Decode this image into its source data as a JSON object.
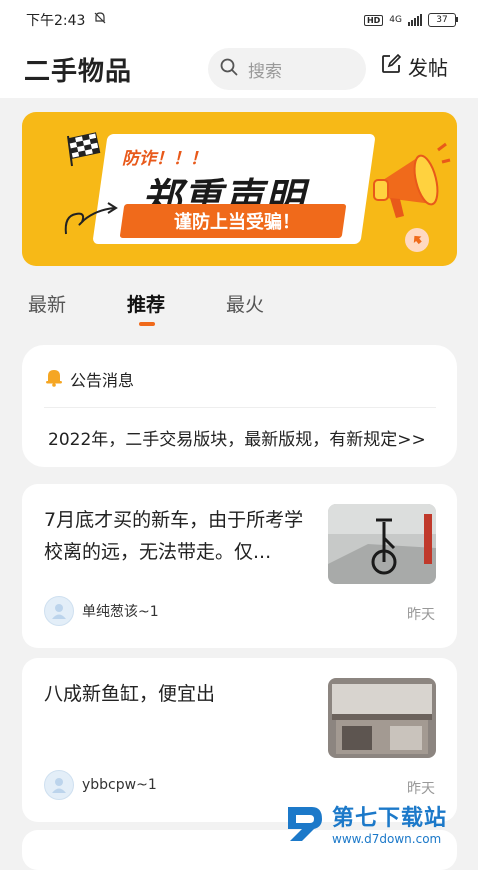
{
  "status_bar": {
    "time": "下午2:43",
    "hd": "HD",
    "network": "4G",
    "battery": "37"
  },
  "header": {
    "title": "二手物品",
    "search_placeholder": "搜索",
    "post_label": "发帖"
  },
  "banner": {
    "tag": "防诈！！！",
    "headline": "郑重声明",
    "subline": "谨防上当受骗！"
  },
  "tabs": [
    {
      "label": "最新",
      "active": false
    },
    {
      "label": "推荐",
      "active": true
    },
    {
      "label": "最火",
      "active": false
    }
  ],
  "notice": {
    "title": "公告消息",
    "text": "2022年，二手交易版块，最新版规，有新规定>>"
  },
  "posts": [
    {
      "title": "7月底才买的新车，由于所考学校离的远，无法带走。仅...",
      "author": "单纯葱该~1",
      "time": "昨天",
      "thumbnail": "bicycle-photo"
    },
    {
      "title": "八成新鱼缸，便宜出",
      "author": "ybbcpw~1",
      "time": "昨天",
      "thumbnail": "fish-tank-photo"
    }
  ],
  "watermark": {
    "title": "第七下载站",
    "url": "www.d7down.com"
  },
  "colors": {
    "accent": "#f06a1b",
    "banner_bg": "#f7b917",
    "page_bg": "#f2f2f2"
  }
}
